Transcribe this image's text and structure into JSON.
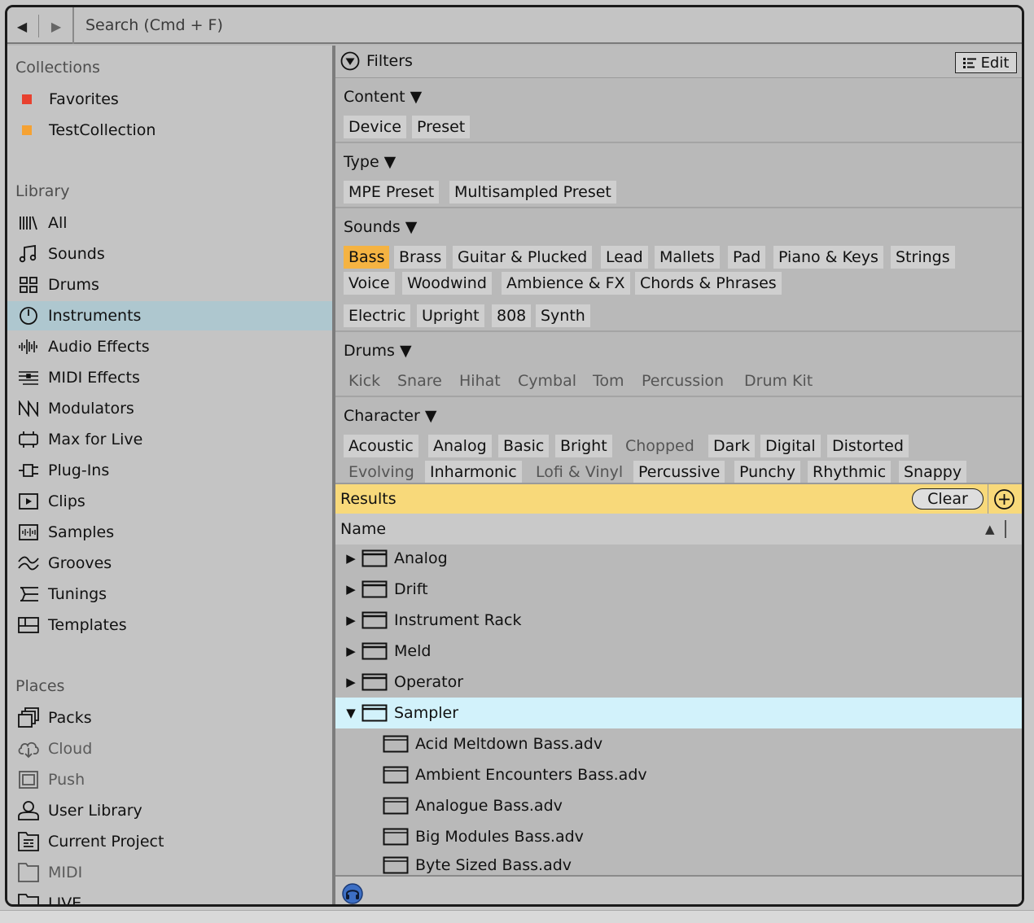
{
  "search": {
    "placeholder": "Search (Cmd + F)"
  },
  "sidebar": {
    "collections_heading": "Collections",
    "collections": [
      {
        "label": "Favorites",
        "color": "#e8412f"
      },
      {
        "label": "TestCollection",
        "color": "#f5a233"
      }
    ],
    "library_heading": "Library",
    "library": [
      {
        "label": "All",
        "icon": "library-icon"
      },
      {
        "label": "Sounds",
        "icon": "music-note-icon"
      },
      {
        "label": "Drums",
        "icon": "drum-grid-icon"
      },
      {
        "label": "Instruments",
        "icon": "clock-instrument-icon",
        "selected": true
      },
      {
        "label": "Audio Effects",
        "icon": "waveform-icon"
      },
      {
        "label": "MIDI Effects",
        "icon": "midi-lines-icon"
      },
      {
        "label": "Modulators",
        "icon": "modulator-icon"
      },
      {
        "label": "Max for Live",
        "icon": "max-for-live-icon"
      },
      {
        "label": "Plug-Ins",
        "icon": "plug-icon"
      },
      {
        "label": "Clips",
        "icon": "clip-play-icon"
      },
      {
        "label": "Samples",
        "icon": "sample-wave-icon"
      },
      {
        "label": "Grooves",
        "icon": "groove-wave-icon"
      },
      {
        "label": "Tunings",
        "icon": "tuning-icon"
      },
      {
        "label": "Templates",
        "icon": "template-icon"
      }
    ],
    "places_heading": "Places",
    "places": [
      {
        "label": "Packs",
        "icon": "packs-icon"
      },
      {
        "label": "Cloud",
        "icon": "cloud-icon",
        "dim": true
      },
      {
        "label": "Push",
        "icon": "push-icon",
        "dim": true
      },
      {
        "label": "User Library",
        "icon": "user-icon"
      },
      {
        "label": "Current Project",
        "icon": "project-folder-icon"
      },
      {
        "label": "MIDI",
        "icon": "folder-icon",
        "dim": true
      },
      {
        "label": "LIVE",
        "icon": "folder-icon"
      }
    ]
  },
  "filters": {
    "title": "Filters",
    "edit_label": "Edit",
    "sections": {
      "content": {
        "title": "Content",
        "chips": [
          "Device",
          "Preset"
        ]
      },
      "type": {
        "title": "Type",
        "chips": [
          "MPE Preset",
          "Multisampled Preset"
        ]
      },
      "sounds": {
        "title": "Sounds",
        "chips": [
          "Bass",
          "Brass",
          "Guitar & Plucked",
          "Lead",
          "Mallets",
          "Pad",
          "Piano & Keys",
          "Strings",
          "Voice",
          "Woodwind",
          "Ambience & FX",
          "Chords & Phrases",
          "Electric",
          "Upright",
          "808",
          "Synth"
        ]
      },
      "drums": {
        "title": "Drums",
        "chips": [
          "Kick",
          "Snare",
          "Hihat",
          "Cymbal",
          "Tom",
          "Percussion",
          "Drum Kit"
        ]
      },
      "character": {
        "title": "Character",
        "chips": [
          "Acoustic",
          "Analog",
          "Basic",
          "Bright",
          "Chopped",
          "Dark",
          "Digital",
          "Distorted",
          "Evolving",
          "Inharmonic",
          "Lofi & Vinyl",
          "Percussive",
          "Punchy",
          "Rhythmic",
          "Snappy"
        ]
      }
    }
  },
  "results": {
    "title": "Results",
    "clear_label": "Clear",
    "name_column": "Name",
    "rows": [
      "Analog",
      "Drift",
      "Instrument Rack",
      "Meld",
      "Operator",
      "Sampler"
    ],
    "children": [
      "Acid Meltdown Bass.adv",
      "Ambient Encounters Bass.adv",
      "Analogue Bass.adv",
      "Big Modules Bass.adv",
      "Byte Sized Bass.adv"
    ]
  },
  "colors": {
    "selected_row": "#aec7cf",
    "expanded_row": "#d2f2fb",
    "active_chip": "#f5b342",
    "results_bar": "#f8d97a"
  }
}
